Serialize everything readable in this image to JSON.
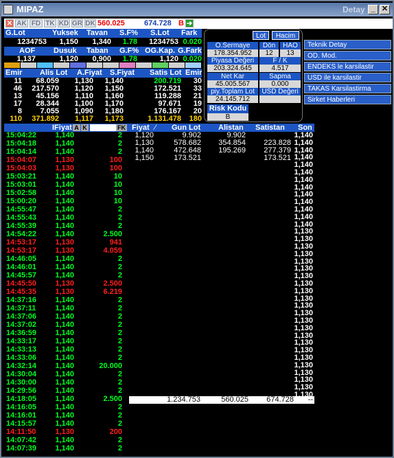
{
  "window": {
    "title": "MIPAZ",
    "detail_label": "Detay"
  },
  "toolbar": {
    "tabs": [
      "AK",
      "FD",
      "TK",
      "KD",
      "GR",
      "DK"
    ],
    "value1": "560.025",
    "value2": "674.728",
    "b_label": "B"
  },
  "summary": {
    "headers1": [
      "G.Lot",
      "Yuksek",
      "Tavan",
      "S.F%",
      "S.Lot",
      "Fark"
    ],
    "values1": [
      "1234753",
      "1,150",
      "1,340",
      "1.78",
      "1234753",
      "0.020"
    ],
    "headers2": [
      "AOF",
      "Dusuk",
      "Taban",
      "G.F%",
      "OG.Kap.",
      "G.Fark"
    ],
    "values2": [
      "1,137",
      "1,120",
      "0,900",
      "1.78",
      "1,120",
      "0.020"
    ]
  },
  "depth": {
    "headers": [
      "Emir",
      "Alis Lot",
      "A.Fiyat",
      "S.Fiyat",
      "Satis Lot",
      "Emir"
    ],
    "rows": [
      [
        "11",
        "68.059",
        "1,130",
        "1,140",
        "200.719",
        "30"
      ],
      [
        "46",
        "217.570",
        "1,120",
        "1,150",
        "172.521",
        "33"
      ],
      [
        "13",
        "45.156",
        "1,110",
        "1,160",
        "119.288",
        "21"
      ],
      [
        "17",
        "28.344",
        "1,100",
        "1,170",
        "97.671",
        "19"
      ],
      [
        "8",
        "7.055",
        "1,090",
        "1,180",
        "176.167",
        "20"
      ],
      [
        "110",
        "371.892",
        "1,117",
        "1,173",
        "1.131.478",
        "180"
      ]
    ]
  },
  "panel": {
    "buttons": [
      "Lot",
      "Hacim"
    ],
    "fields": [
      {
        "label": "O.Sermaye",
        "value": "178.354.952"
      },
      {
        "label": "Dön",
        "value": "12"
      },
      {
        "label": "HAO",
        "value": "13"
      },
      {
        "label": "Piyasa Değeri",
        "value": "203.324.645"
      },
      {
        "label": "F / K",
        "value": "4.517"
      },
      {
        "label": "Net Kar",
        "value": "45.005.567"
      },
      {
        "label": "Sapma",
        "value": "0.000"
      },
      {
        "label": "piy.Toplam Lot",
        "value": "24.145.712"
      },
      {
        "label": "USD Değeri",
        "value": ""
      }
    ],
    "risk_label": "Risk Kodu",
    "risk_value": "B"
  },
  "side_menu": [
    "Teknik Detay",
    "OD. Mod.",
    "ENDEKS le karsilastir",
    "USD ile karsilastir",
    "TAKAS Karsilastirma",
    "Sirket Haberleri"
  ],
  "trade_header": {
    "fiyat": "IFiyat",
    "a": "A",
    "k": "K",
    "fk": "FK",
    "fiyat2": "Fiyat",
    "gunlot": "Gun Lot",
    "alistan": "Alistan",
    "satistan": "Satistan",
    "son": "Son"
  },
  "trades": [
    [
      "15:04:22",
      "1,140",
      "2",
      "g"
    ],
    [
      "15:04:18",
      "1,140",
      "2",
      "g"
    ],
    [
      "15:04:14",
      "1,140",
      "2",
      "g"
    ],
    [
      "15:04:07",
      "1,130",
      "100",
      "r"
    ],
    [
      "15:04:03",
      "1,130",
      "100",
      "r"
    ],
    [
      "15:03:21",
      "1,140",
      "10",
      "g"
    ],
    [
      "15:03:01",
      "1,140",
      "10",
      "g"
    ],
    [
      "15:02:58",
      "1,140",
      "10",
      "g"
    ],
    [
      "15:00:20",
      "1,140",
      "10",
      "g"
    ],
    [
      "14:55:47",
      "1,140",
      "2",
      "g"
    ],
    [
      "14:55:43",
      "1,140",
      "2",
      "g"
    ],
    [
      "14:55:39",
      "1,140",
      "2",
      "g"
    ],
    [
      "14:54:22",
      "1,140",
      "2.500",
      "g"
    ],
    [
      "14:53:17",
      "1,130",
      "941",
      "r"
    ],
    [
      "14:53:17",
      "1,130",
      "4.059",
      "r"
    ],
    [
      "14:46:05",
      "1,140",
      "2",
      "g"
    ],
    [
      "14:46:01",
      "1,140",
      "2",
      "g"
    ],
    [
      "14:45:57",
      "1,140",
      "2",
      "g"
    ],
    [
      "14:45:50",
      "1,130",
      "2.500",
      "r"
    ],
    [
      "14:45:35",
      "1,130",
      "6.219",
      "r"
    ],
    [
      "14:37:16",
      "1,140",
      "2",
      "g"
    ],
    [
      "14:37:11",
      "1,140",
      "2",
      "g"
    ],
    [
      "14:37:06",
      "1,140",
      "2",
      "g"
    ],
    [
      "14:37:02",
      "1,140",
      "2",
      "g"
    ],
    [
      "14:36:59",
      "1,140",
      "2",
      "g"
    ],
    [
      "14:33:17",
      "1,140",
      "2",
      "g"
    ],
    [
      "14:33:13",
      "1,140",
      "2",
      "g"
    ],
    [
      "14:33:06",
      "1,140",
      "2",
      "g"
    ],
    [
      "14:32:14",
      "1,140",
      "20.000",
      "g"
    ],
    [
      "14:30:04",
      "1,140",
      "2",
      "g"
    ],
    [
      "14:30:00",
      "1,140",
      "2",
      "g"
    ],
    [
      "14:29:56",
      "1,140",
      "2",
      "g"
    ],
    [
      "14:18:05",
      "1,140",
      "2.500",
      "g"
    ],
    [
      "14:16:05",
      "1,140",
      "2",
      "g"
    ],
    [
      "14:16:01",
      "1,140",
      "2",
      "g"
    ],
    [
      "14:15:57",
      "1,140",
      "2",
      "g"
    ],
    [
      "14:11:50",
      "1,130",
      "200",
      "r"
    ],
    [
      "14:07:42",
      "1,140",
      "2",
      "g"
    ],
    [
      "14:07:39",
      "1,140",
      "2",
      "g"
    ]
  ],
  "book": [
    [
      "1,120",
      "9.902",
      "9.902",
      ""
    ],
    [
      "1,130",
      "578.682",
      "354.854",
      "223.828"
    ],
    [
      "1,140",
      "472.648",
      "195.269",
      "277.379"
    ],
    [
      "1,150",
      "173.521",
      "",
      "173.521"
    ]
  ],
  "son_rows": [
    "1,140",
    "1,140",
    "1,140",
    "1,140",
    "1,140",
    "1,140",
    "1,140",
    "1,140",
    "1,140",
    "1,140",
    "1,140",
    "1,140",
    "1,140",
    "1,130",
    "1,130",
    "1,130",
    "1,130",
    "1,130",
    "1,130",
    "1,130",
    "1,130",
    "1,130",
    "1,130",
    "1,130",
    "1,130",
    "1,130",
    "1,130",
    "1,130",
    "1,130",
    "1,130",
    "1,130",
    "1,130",
    "1,130",
    "1,130",
    "1,130",
    "1,130"
  ],
  "totals": {
    "gunlot": "1.234.753",
    "alistan": "560.025",
    "satistan": "674.728",
    "son": "--"
  },
  "colors": {
    "green": "#00ff21",
    "red": "#ff1e1e",
    "yellow": "#ffd200",
    "header_blue": "#1d56c4"
  }
}
